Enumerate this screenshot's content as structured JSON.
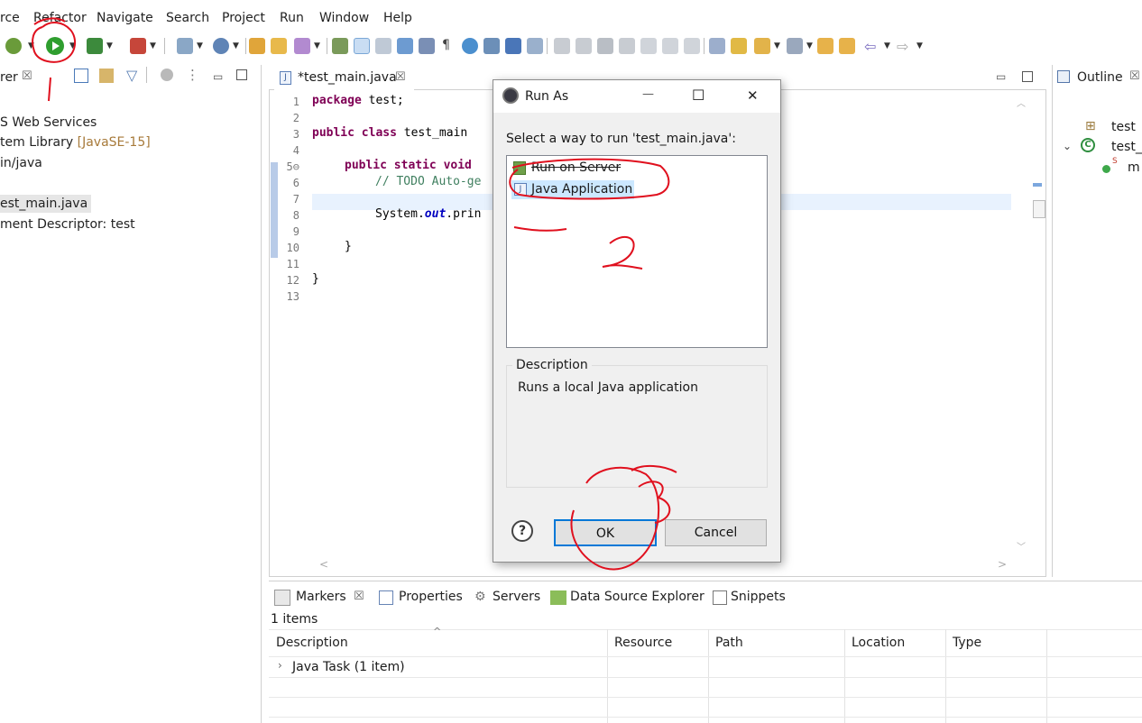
{
  "menubar": {
    "items": [
      "rce",
      "Refactor",
      "Navigate",
      "Search",
      "Project",
      "Run",
      "Window",
      "Help"
    ]
  },
  "left_panel": {
    "title": "rer",
    "close_glyph": "☒",
    "tree": [
      "S Web Services",
      "tem Library",
      "[JavaSE-15]",
      "in/java",
      "est_main.java",
      "ment Descriptor: test"
    ]
  },
  "editor": {
    "tab_label": "*test_main.java",
    "tab_close": "☒",
    "line_numbers": [
      "1",
      "2",
      "3",
      "4",
      "5⊖",
      "6",
      "7",
      "8",
      "9",
      "10",
      "11",
      "12",
      "13"
    ],
    "code": {
      "l1_kw": "package",
      "l1_rest": " test;",
      "l3_kw": "public class",
      "l3_rest": " test_main",
      "l5_kw": "public static void",
      "l6_comment": "// TODO Auto-ge",
      "l8_pre": "System.",
      "l8_out": "out",
      "l8_post": ".prin",
      "l10": "}",
      "l12": "}"
    }
  },
  "outline": {
    "title": "Outline",
    "close_glyph": "☒",
    "items": [
      "test",
      "test_r",
      "m"
    ]
  },
  "bottom": {
    "tabs": [
      "Markers",
      "Properties",
      "Servers",
      "Data Source Explorer",
      "Snippets"
    ],
    "count": "1 items",
    "columns": [
      "Description",
      "Resource",
      "Path",
      "Location",
      "Type"
    ],
    "rows": [
      {
        "description": "Java Task (1 item)"
      }
    ]
  },
  "dialog": {
    "title": "Run As",
    "prompt": "Select a way to run 'test_main.java':",
    "options": [
      "Run on Server",
      "Java Application"
    ],
    "description_label": "Description",
    "description_text": "Runs a local Java application",
    "ok": "OK",
    "cancel": "Cancel",
    "help": "?",
    "minimize": "—",
    "maximize": "☐",
    "close": "✕"
  },
  "annotations": {
    "step1": "1",
    "step2": "2",
    "step3": "3",
    "color": "#e0101e"
  },
  "colors": {
    "selection": "#cce8ff",
    "current_line": "#e8f2fe",
    "keyword": "#7f0055",
    "comment": "#3f7f5f"
  }
}
